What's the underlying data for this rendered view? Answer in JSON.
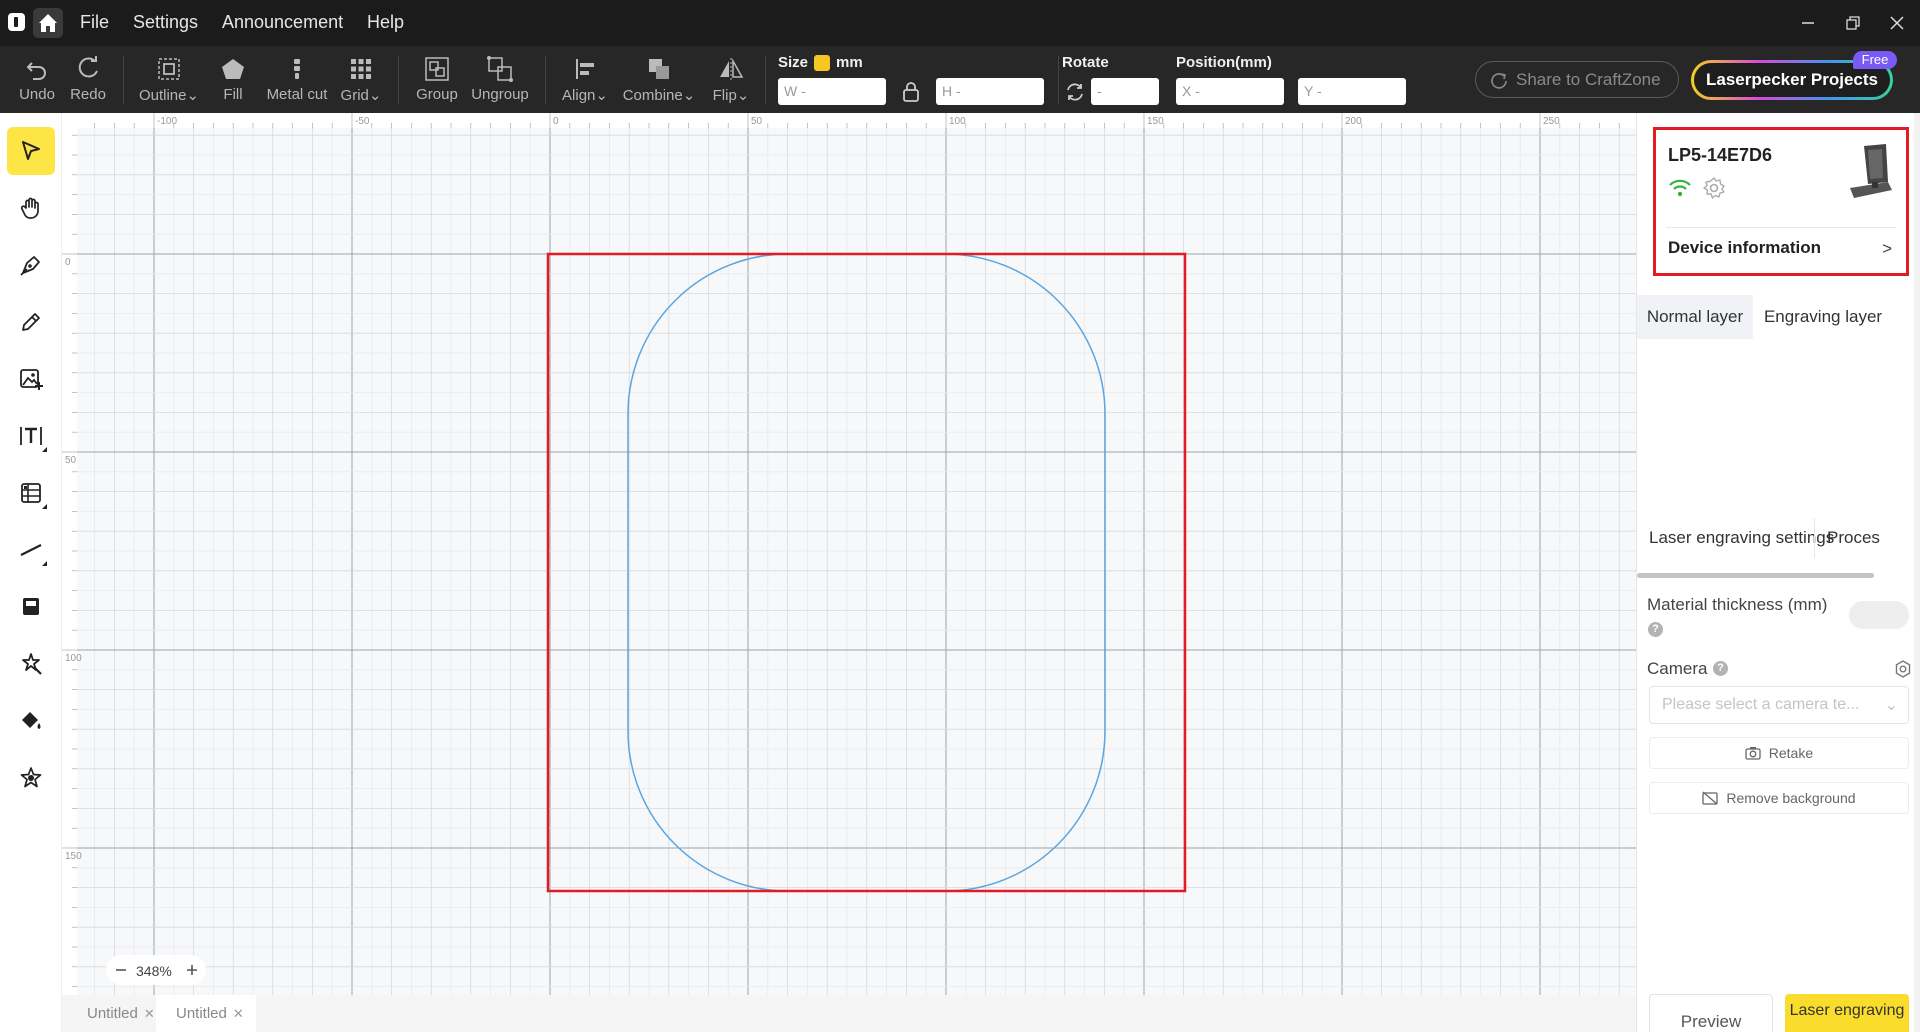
{
  "titlebar": {
    "menus": [
      "File",
      "Settings",
      "Announcement",
      "Help"
    ]
  },
  "toolbar": {
    "tools": [
      {
        "label": "Undo",
        "icon": "undo-icon"
      },
      {
        "label": "Redo",
        "icon": "redo-icon"
      },
      {
        "label": "Outline",
        "icon": "outline-icon",
        "dropdown": true
      },
      {
        "label": "Fill",
        "icon": "fill-shape-icon"
      },
      {
        "label": "Metal cut",
        "icon": "metal-cut-icon"
      },
      {
        "label": "Grid",
        "icon": "grid-icon",
        "dropdown": true
      },
      {
        "label": "Group",
        "icon": "group-icon"
      },
      {
        "label": "Ungroup",
        "icon": "ungroup-icon"
      },
      {
        "label": "Align",
        "icon": "align-icon",
        "dropdown": true
      },
      {
        "label": "Combine",
        "icon": "combine-icon",
        "dropdown": true
      },
      {
        "label": "Flip",
        "icon": "flip-icon",
        "dropdown": true
      }
    ],
    "size_label": "Size",
    "unit": "mm",
    "width_placeholder": "W -",
    "height_placeholder": "H -",
    "rotate_label": "Rotate",
    "rotate_placeholder": "-",
    "position_label": "Position(mm)",
    "x_placeholder": "X -",
    "y_placeholder": "Y -",
    "share_label": "Share to CraftZone",
    "projects_label": "Laserpecker Projects",
    "free_badge": "Free"
  },
  "leftbar": {
    "tools": [
      "select-icon",
      "hand-icon",
      "pen-icon",
      "pencil-icon",
      "image-add-icon",
      "text-icon",
      "table-icon",
      "line-icon",
      "stamp-icon",
      "magic-icon",
      "paint-bucket-icon",
      "material-library-icon"
    ],
    "active": "select-icon"
  },
  "canvas": {
    "ruler_x": [
      "-100",
      "-50",
      "0",
      "50",
      "100",
      "150",
      "200",
      "250"
    ],
    "ruler_y": [
      "0",
      "50",
      "100",
      "150"
    ],
    "zoom": "348%"
  },
  "doc_tabs": [
    "Untitled",
    "Untitled"
  ],
  "rightpanel": {
    "device_name": "LP5-14E7D6",
    "device_info_label": "Device information",
    "layer_tabs": [
      "Normal layer",
      "Engraving layer"
    ],
    "settings_tabs": [
      "Laser engraving settings",
      "Proces"
    ],
    "material_thickness_label": "Material thickness (mm)",
    "camera_label": "Camera",
    "camera_placeholder": "Please select a camera te...",
    "retake_label": "Retake",
    "remove_bg_label": "Remove background",
    "preview_label": "Preview",
    "engrave_label": "Laser engraving"
  },
  "colors": {
    "accent": "#fde545",
    "selection": "#e21b24",
    "shape_stroke": "#5aa5e0",
    "wifi": "#2fb53f"
  }
}
